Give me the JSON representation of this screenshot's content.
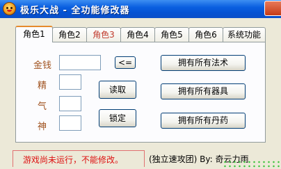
{
  "window": {
    "title": "极乐大战 - 全功能修改器",
    "app_icon": "cartoon-face-icon",
    "close_icon": "close-icon"
  },
  "tabs": [
    {
      "label": "角色1",
      "active": true
    },
    {
      "label": "角色2"
    },
    {
      "label": "角色3"
    },
    {
      "label": "角色4"
    },
    {
      "label": "角色5"
    },
    {
      "label": "角色6"
    },
    {
      "label": "系统功能"
    }
  ],
  "fields": {
    "money_label": "金钱",
    "essence_label": "精",
    "qi_label": "气",
    "spirit_label": "神",
    "money_value": "",
    "essence_value": "",
    "qi_value": "",
    "spirit_value": ""
  },
  "buttons": {
    "arrow": "<=",
    "read": "读取",
    "lock": "锁定",
    "all_spells": "拥有所有法术",
    "all_equipment": "拥有所有器具",
    "all_pills": "拥有所有丹药"
  },
  "status": {
    "message": "游戏尚未运行，不能修改。",
    "credit": "(独立速攻团)  By: 奇云力雨"
  },
  "colors": {
    "accent": "#e68b2c",
    "label": "#a0521f",
    "error": "#dd1111",
    "titlebar": "#0a5fe0"
  }
}
